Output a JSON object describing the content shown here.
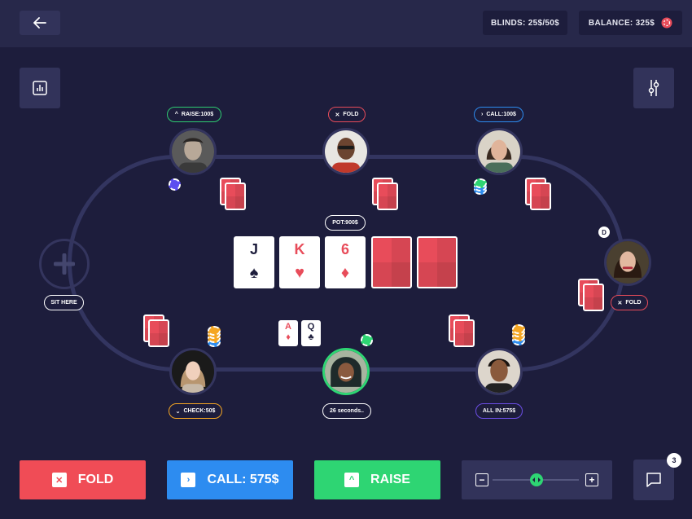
{
  "header": {
    "blinds": "BLINDS: 25$/50$",
    "balance": "BALANCE: 325$"
  },
  "icons": {
    "back": "arrow-left-icon",
    "stats": "bar-chart-icon",
    "settings": "sliders-icon",
    "chat": "chat-icon",
    "add": "plus-icon"
  },
  "table": {
    "pot": "POT:900$",
    "community_cards": [
      {
        "rank": "J",
        "suit": "♠",
        "color": "#1d1d3c",
        "face_up": true
      },
      {
        "rank": "K",
        "suit": "♥",
        "color": "#e84c5a",
        "face_up": true
      },
      {
        "rank": "6",
        "suit": "♦",
        "color": "#e84c5a",
        "face_up": true
      },
      {
        "face_up": false
      },
      {
        "face_up": false
      }
    ],
    "dealer_button": "D"
  },
  "players": [
    {
      "seat": "top-left",
      "status": "RAISE:100$",
      "status_icon": "^",
      "status_color": "#2ecc71"
    },
    {
      "seat": "top-center",
      "status": "FOLD",
      "status_icon": "✕",
      "status_color": "#e84c5a"
    },
    {
      "seat": "top-right",
      "status": "CALL:100$",
      "status_icon": "›",
      "status_color": "#2d8cf0"
    },
    {
      "seat": "right",
      "status": "FOLD",
      "status_icon": "✕",
      "status_color": "#e84c5a"
    },
    {
      "seat": "bottom-right",
      "status": "ALL IN:575$",
      "status_icon": "",
      "status_color": "#6c4ee6"
    },
    {
      "seat": "bottom-center",
      "status": "26 seconds..",
      "status_icon": "",
      "status_color": "#ffffff",
      "hand": [
        {
          "rank": "A",
          "suit": "♦",
          "color": "#e84c5a"
        },
        {
          "rank": "Q",
          "suit": "♣",
          "color": "#1d1d3c"
        }
      ]
    },
    {
      "seat": "bottom-left",
      "status": "CHECK:50$",
      "status_icon": "⌄",
      "status_color": "#f5a623"
    }
  ],
  "empty_seat": {
    "label": "SIT HERE"
  },
  "actions": {
    "fold": {
      "label": "FOLD",
      "icon": "✕",
      "color": "#f04c56"
    },
    "call": {
      "label": "CALL: 575$",
      "icon": "›",
      "color": "#2d8cf0"
    },
    "raise": {
      "label": "RAISE",
      "icon": "^",
      "color": "#2ed573"
    }
  },
  "raise_slider": {
    "minus": "−",
    "plus": "+",
    "value": 0.5
  },
  "chat": {
    "unread": "3"
  }
}
